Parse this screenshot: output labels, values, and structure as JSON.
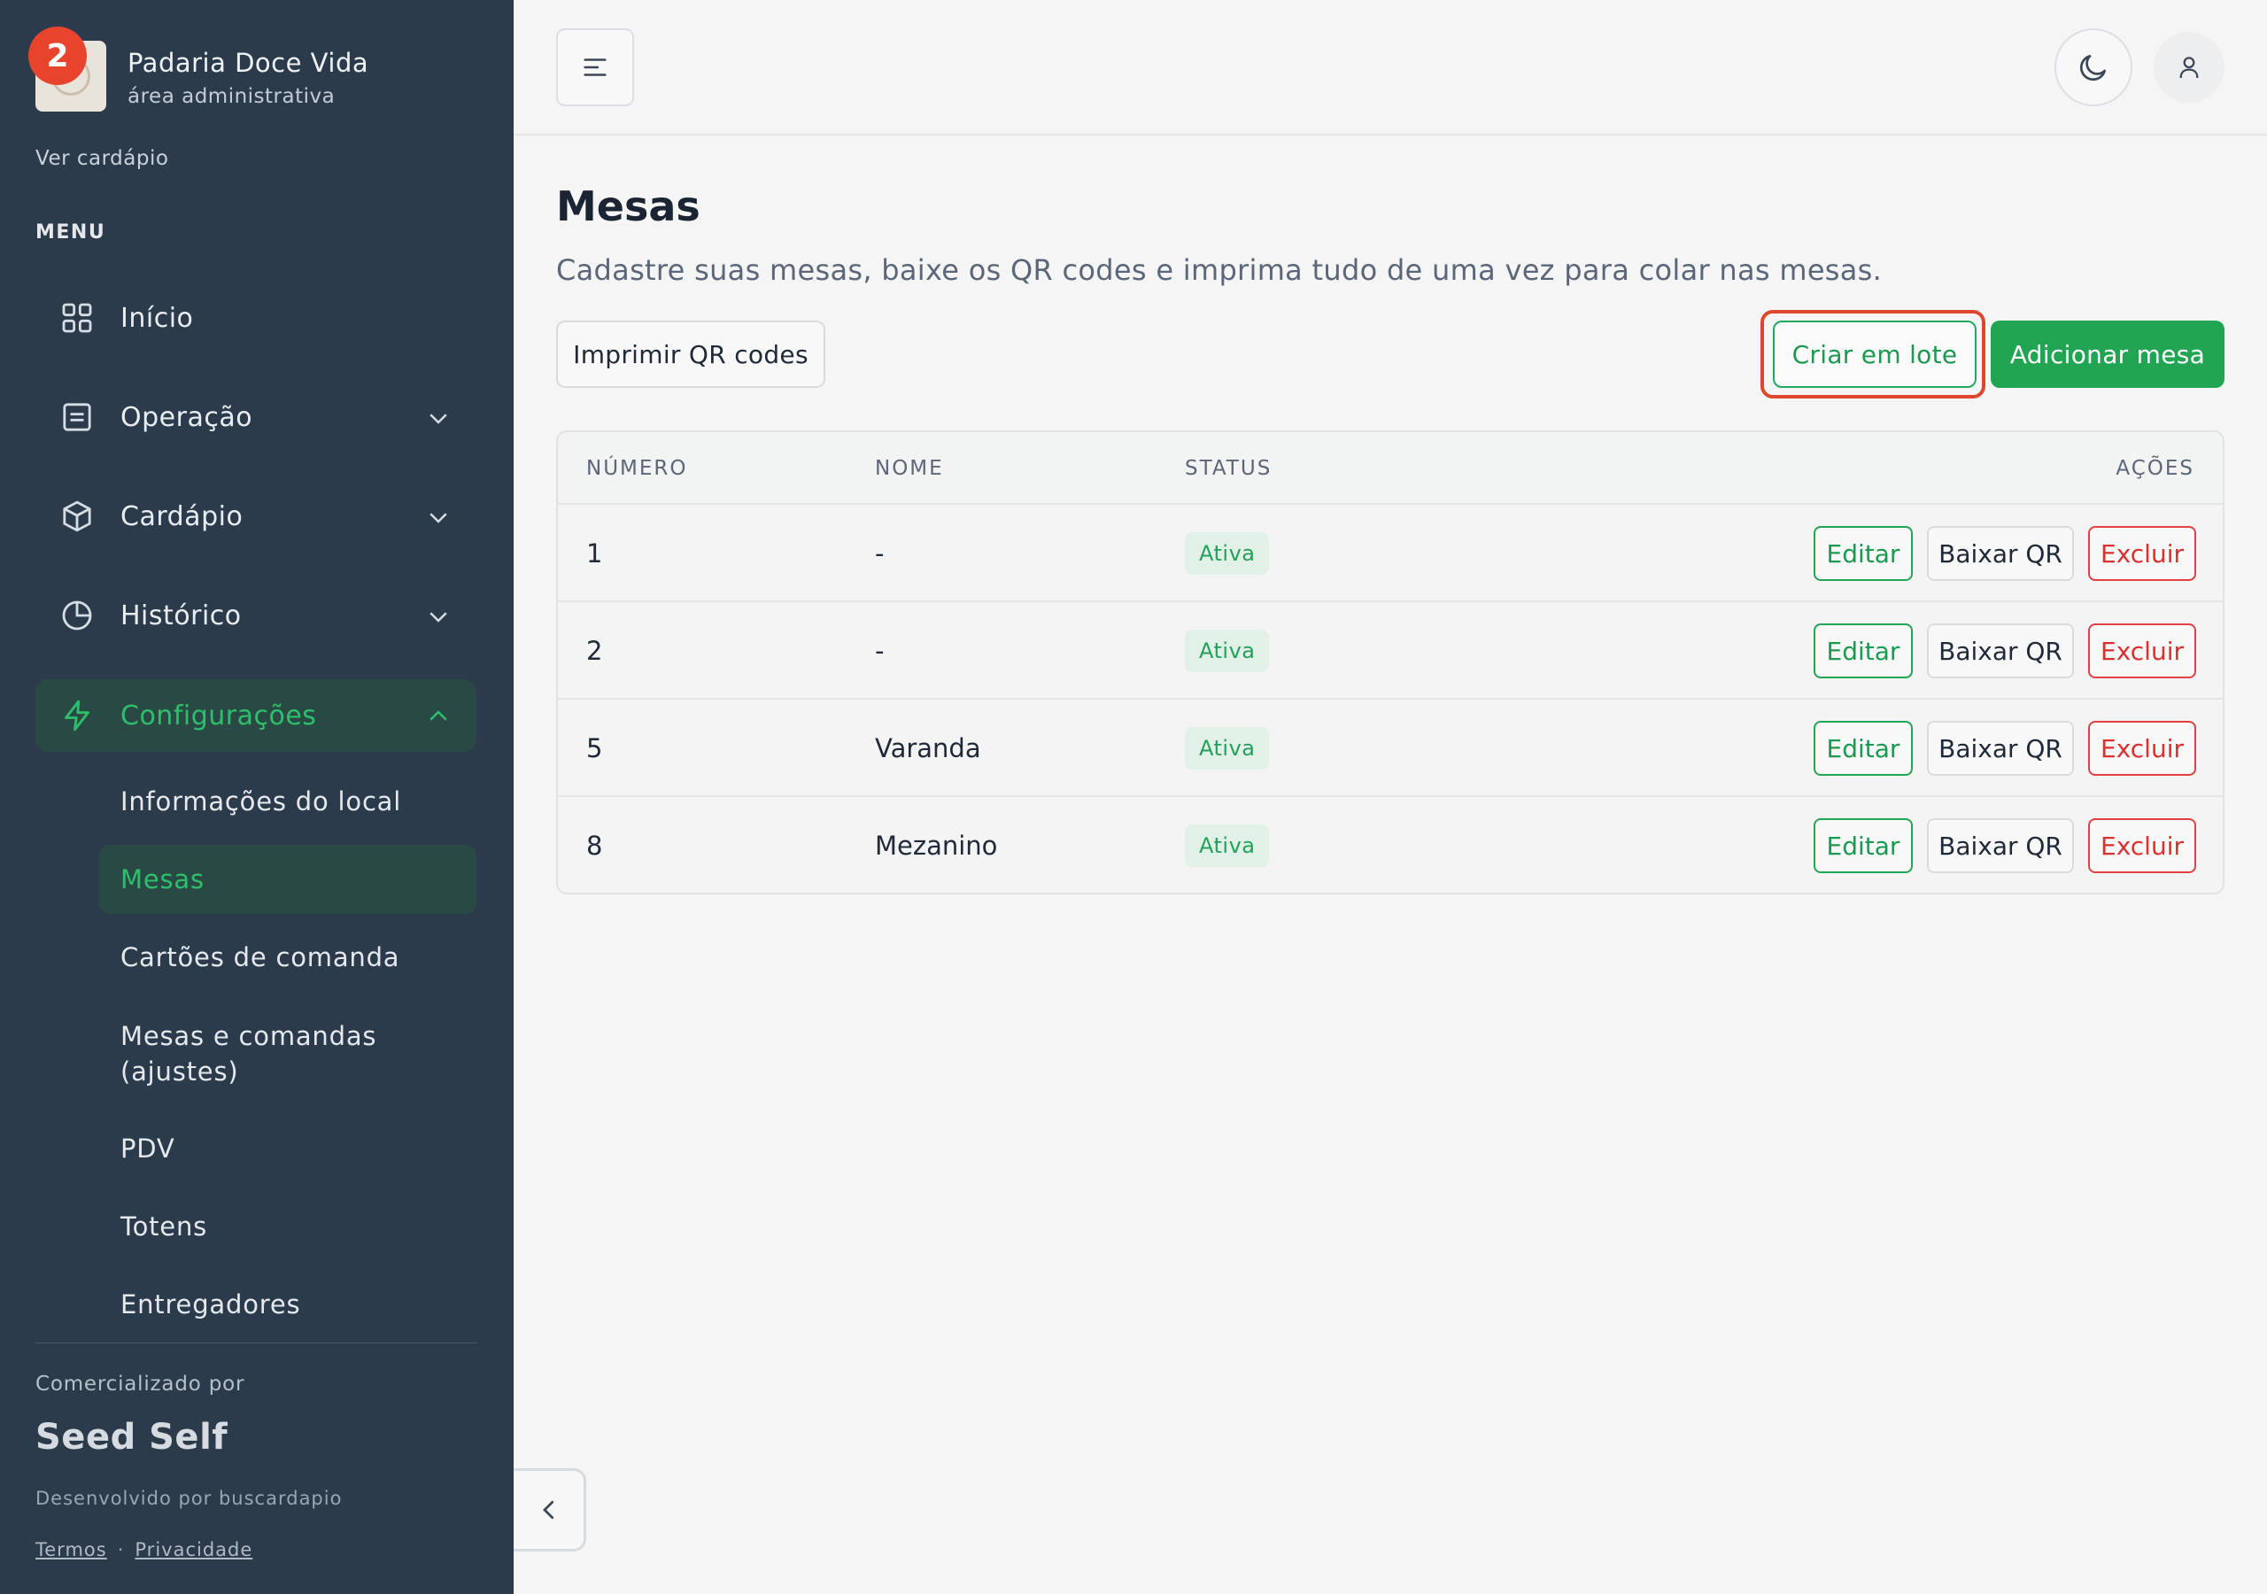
{
  "brand": {
    "name": "Padaria Doce Vida",
    "subtitle": "área administrativa",
    "notification_count": "2",
    "view_menu_link": "Ver cardápio"
  },
  "sidebar": {
    "menu_label": "MENU",
    "items": [
      {
        "label": "Início",
        "icon": "grid-icon"
      },
      {
        "label": "Operação",
        "icon": "document-icon"
      },
      {
        "label": "Cardápio",
        "icon": "box-icon"
      },
      {
        "label": "Histórico",
        "icon": "pie-chart-icon"
      },
      {
        "label": "Configurações",
        "icon": "lightning-icon",
        "active": true
      }
    ],
    "subitems": [
      {
        "label": "Informações do local"
      },
      {
        "label": "Mesas",
        "active": true
      },
      {
        "label": "Cartões de comanda"
      },
      {
        "label": "Mesas e comandas (ajustes)"
      },
      {
        "label": "PDV"
      },
      {
        "label": "Totens"
      },
      {
        "label": "Entregadores"
      }
    ],
    "footer": {
      "sold_by": "Comercializado por",
      "company": "Seed Self",
      "developed_by": "Desenvolvido por buscardapio",
      "terms": "Termos",
      "separator": "·",
      "privacy": "Privacidade"
    }
  },
  "page": {
    "title": "Mesas",
    "description": "Cadastre suas mesas, baixe os QR codes e imprima tudo de uma vez para colar nas mesas.",
    "print_button": "Imprimir QR codes",
    "batch_button": "Criar em lote",
    "add_button": "Adicionar mesa"
  },
  "table": {
    "headers": {
      "number": "NÚMERO",
      "name": "NOME",
      "status": "STATUS",
      "actions": "AÇÕES"
    },
    "rows": [
      {
        "number": "1",
        "name": "-",
        "status": "Ativa"
      },
      {
        "number": "2",
        "name": "-",
        "status": "Ativa"
      },
      {
        "number": "5",
        "name": "Varanda",
        "status": "Ativa"
      },
      {
        "number": "8",
        "name": "Mezanino",
        "status": "Ativa"
      }
    ],
    "actions": {
      "edit": "Editar",
      "download_qr": "Baixar QR",
      "delete": "Excluir"
    }
  },
  "colors": {
    "sidebar_bg": "#2b3b4c",
    "accent_green": "#22a552",
    "danger_red": "#d93030",
    "highlight": "#e0452e"
  }
}
